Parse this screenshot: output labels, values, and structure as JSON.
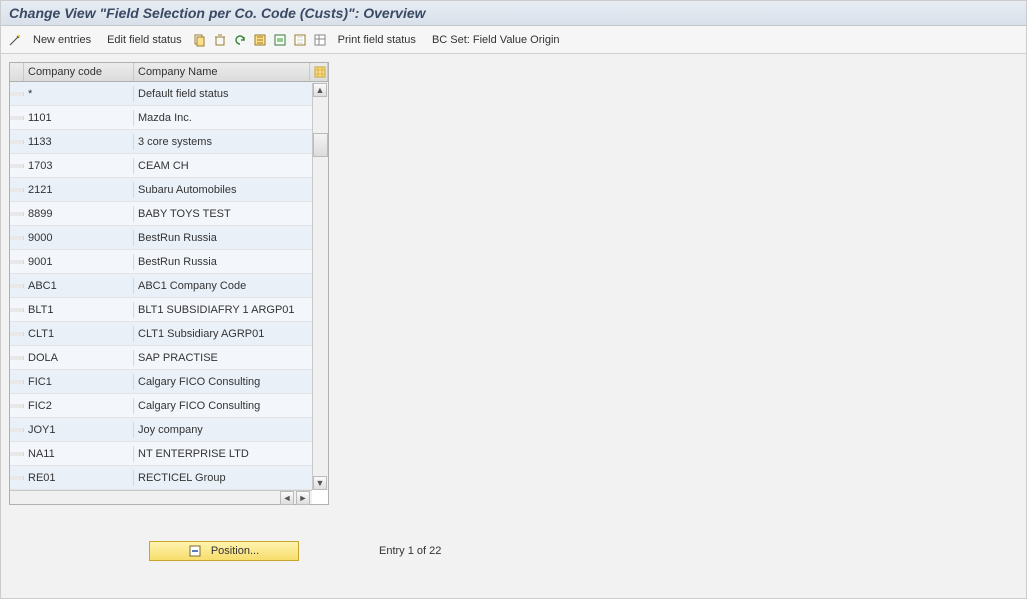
{
  "title": "Change View \"Field Selection per Co. Code (Custs)\": Overview",
  "toolbar": {
    "new_entries": "New entries",
    "edit_field_status": "Edit field status",
    "print_field_status": "Print field status",
    "bc_set": "BC Set: Field Value Origin"
  },
  "grid": {
    "columns": {
      "company_code": "Company code",
      "company_name": "Company Name"
    },
    "rows": [
      {
        "code": "*",
        "name": "Default field status"
      },
      {
        "code": "1101",
        "name": "Mazda Inc."
      },
      {
        "code": "1133",
        "name": "3 core systems"
      },
      {
        "code": "1703",
        "name": "CEAM CH"
      },
      {
        "code": "2121",
        "name": "Subaru Automobiles"
      },
      {
        "code": "8899",
        "name": "BABY TOYS TEST"
      },
      {
        "code": "9000",
        "name": "BestRun Russia"
      },
      {
        "code": "9001",
        "name": "BestRun Russia"
      },
      {
        "code": "ABC1",
        "name": "ABC1 Company Code"
      },
      {
        "code": "BLT1",
        "name": "BLT1 SUBSIDIAFRY 1 ARGP01"
      },
      {
        "code": "CLT1",
        "name": "CLT1 Subsidiary AGRP01"
      },
      {
        "code": "DOLA",
        "name": "SAP PRACTISE"
      },
      {
        "code": "FIC1",
        "name": "Calgary FICO Consulting"
      },
      {
        "code": "FIC2",
        "name": "Calgary FICO Consulting"
      },
      {
        "code": "JOY1",
        "name": "Joy company"
      },
      {
        "code": "NA11",
        "name": "NT ENTERPRISE LTD"
      },
      {
        "code": "RE01",
        "name": "RECTICEL Group"
      }
    ]
  },
  "footer": {
    "position_btn": "Position...",
    "entry_status": "Entry 1 of 22"
  }
}
